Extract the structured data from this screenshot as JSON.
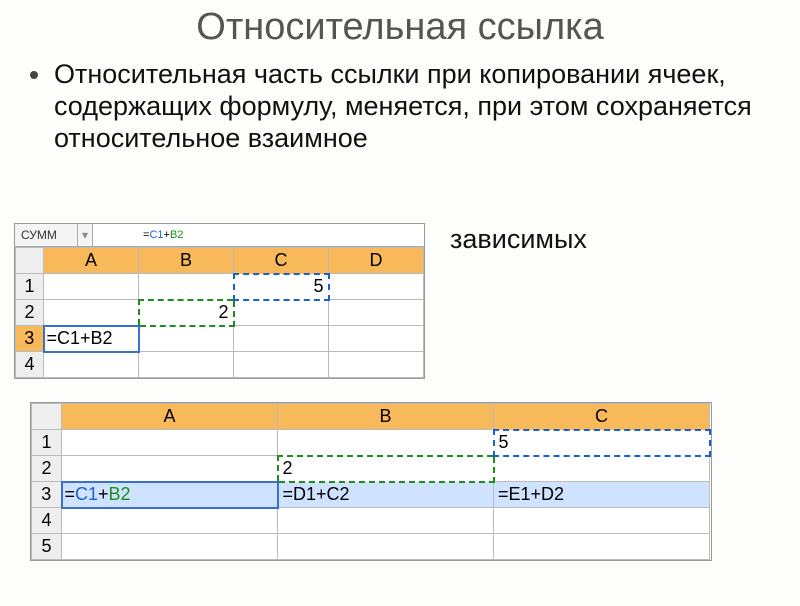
{
  "title": "Относительная ссылка",
  "body_text": "Относительная часть ссылки при копировании ячеек, содержащих формулу, меняется, при этом сохраняется относительное взаимное",
  "trailing_word": "зависимых",
  "sheet1": {
    "name_box": "СУММ",
    "formula_prefix": "=",
    "formula_ref1": "C1",
    "formula_plus": "+",
    "formula_ref2": "B2",
    "cols": [
      "A",
      "B",
      "C",
      "D"
    ],
    "rows": [
      "1",
      "2",
      "3",
      "4"
    ],
    "value_c1": "5",
    "value_b2": "2",
    "cell_a3_formula": "=C1+B2"
  },
  "sheet2": {
    "cols": [
      "A",
      "B",
      "C"
    ],
    "rows": [
      "1",
      "2",
      "3",
      "4",
      "5"
    ],
    "value_c1": "5",
    "value_b2": "2",
    "a3_prefix": "=",
    "a3_ref1": "C1",
    "a3_plus": "+",
    "a3_ref2": "B2",
    "b3_formula": "=D1+C2",
    "c3_formula": "=E1+D2"
  }
}
